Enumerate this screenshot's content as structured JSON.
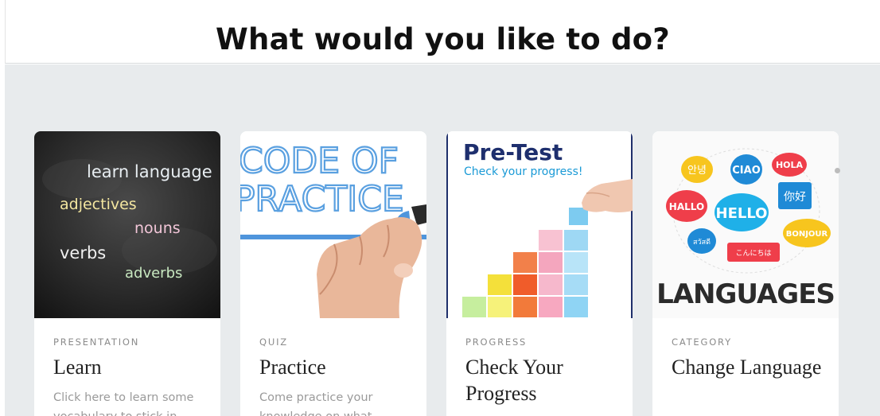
{
  "header": {
    "title": "What would you like to do?"
  },
  "cards": [
    {
      "category": "PRESENTATION",
      "title": "Learn",
      "description": "Click here to learn some vocabulary to stick in",
      "image_words": [
        "learn language",
        "adjectives",
        "nouns",
        "verbs",
        "adverbs"
      ]
    },
    {
      "category": "QUIZ",
      "title": "Practice",
      "description": "Come practice your knowledge on what",
      "image_words": [
        "CODE OF",
        "PRACTICE"
      ]
    },
    {
      "category": "PROGRESS",
      "title": "Check Your Progress",
      "description": "",
      "image_words": [
        "Pre-Test",
        "Check your progress!"
      ]
    },
    {
      "category": "CATEGORY",
      "title": "Change Language",
      "description": "",
      "image_words": [
        "안녕",
        "CIAO",
        "HOLA",
        "HALLO",
        "HELLO",
        "你好",
        "สวัสดี",
        "BONJOUR",
        "こんにちは",
        "LANGUAGES"
      ]
    }
  ],
  "colors": {
    "background": "#e8ebed",
    "card": "#ffffff",
    "category_text": "#8b8b8b",
    "title_text": "#222222"
  }
}
